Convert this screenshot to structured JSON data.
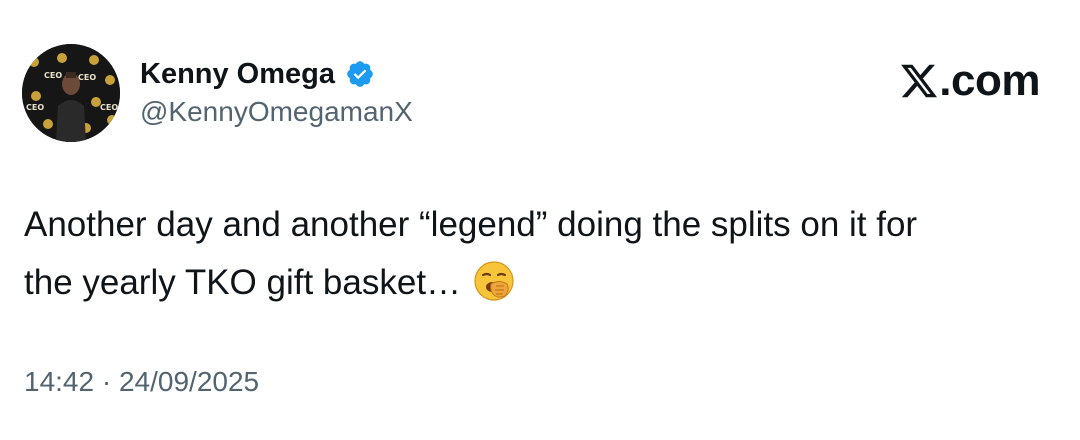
{
  "author": {
    "display_name": "Kenny Omega",
    "handle": "@KennyOmegamanX",
    "verified": true,
    "avatar_icon": "avatar-image",
    "avatar_backdrop_text": "CEO"
  },
  "brand": {
    "suffix": ".com",
    "logo_icon": "x-logo-icon"
  },
  "tweet": {
    "line1": "Another day and another “legend” doing the splits on it for",
    "line2": "the yearly TKO gift basket…",
    "emoji_icon": "yawning-face-emoji"
  },
  "meta": {
    "time": "14:42",
    "separator": "·",
    "date": "24/09/2025"
  },
  "colors": {
    "text": "#0f1419",
    "secondary_text": "#536471",
    "verified_blue": "#1d9bf0",
    "background": "#ffffff"
  }
}
